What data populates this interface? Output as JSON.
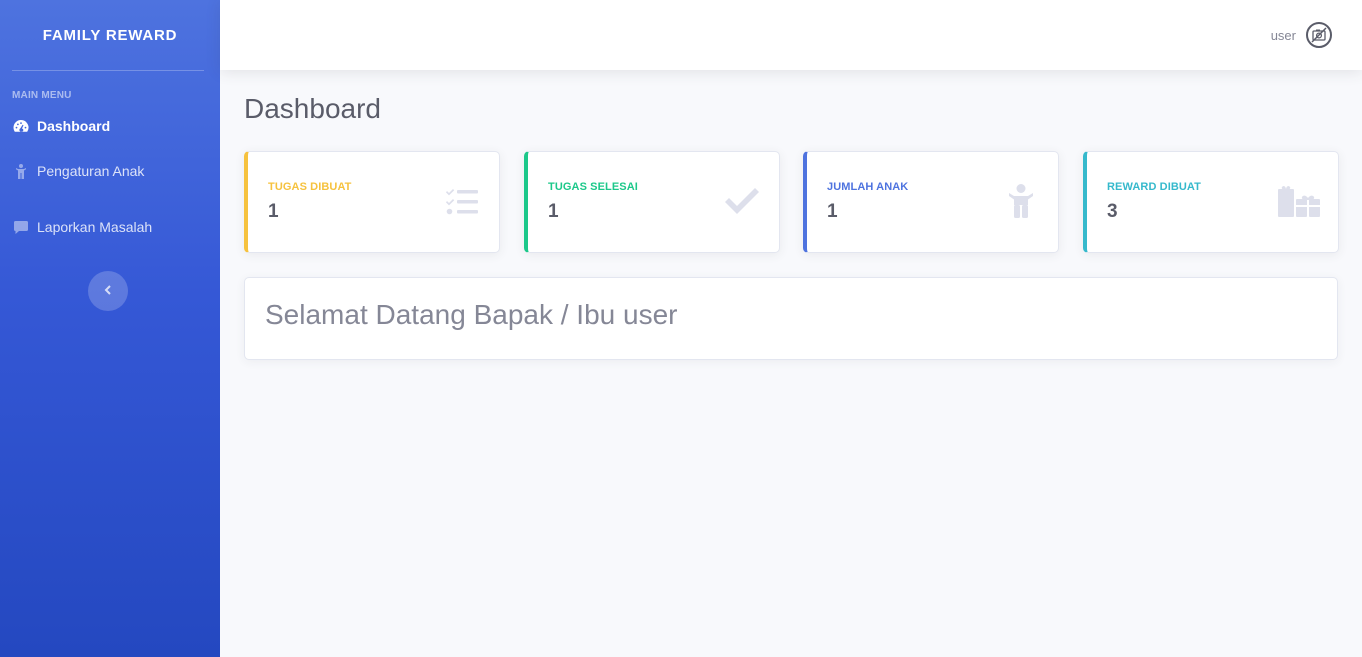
{
  "sidebar": {
    "brand": "FAMILY REWARD",
    "heading": "MAIN MENU",
    "items": [
      {
        "label": "Dashboard",
        "icon": "tachometer-icon",
        "active": true
      },
      {
        "label": "Pengaturan Anak",
        "icon": "child-icon",
        "active": false
      },
      {
        "label": "Laporkan Masalah",
        "icon": "comment-icon",
        "active": false
      }
    ],
    "toggle_icon": "chevron-left-icon"
  },
  "topbar": {
    "user_name": "user",
    "avatar_icon": "no-image-avatar-icon"
  },
  "main": {
    "title": "Dashboard",
    "cards": [
      {
        "label": "TUGAS DIBUAT",
        "value": "1",
        "color": "#f6c23e",
        "icon": "tasks-icon"
      },
      {
        "label": "TUGAS SELESAI",
        "value": "1",
        "color": "#1cc88a",
        "icon": "check-icon"
      },
      {
        "label": "JUMLAH ANAK",
        "value": "1",
        "color": "#4e73df",
        "icon": "child-icon"
      },
      {
        "label": "REWARD DIBUAT",
        "value": "3",
        "color": "#36b9cc",
        "icon": "gifts-icon"
      }
    ],
    "welcome": "Selamat Datang Bapak / Ibu user"
  },
  "colors": {
    "sidebar_top": "#4e73df",
    "sidebar_bottom": "#2448c0",
    "page_bg": "#f8f9fc",
    "text_dark": "#5a5c69",
    "text_muted": "#858796"
  }
}
